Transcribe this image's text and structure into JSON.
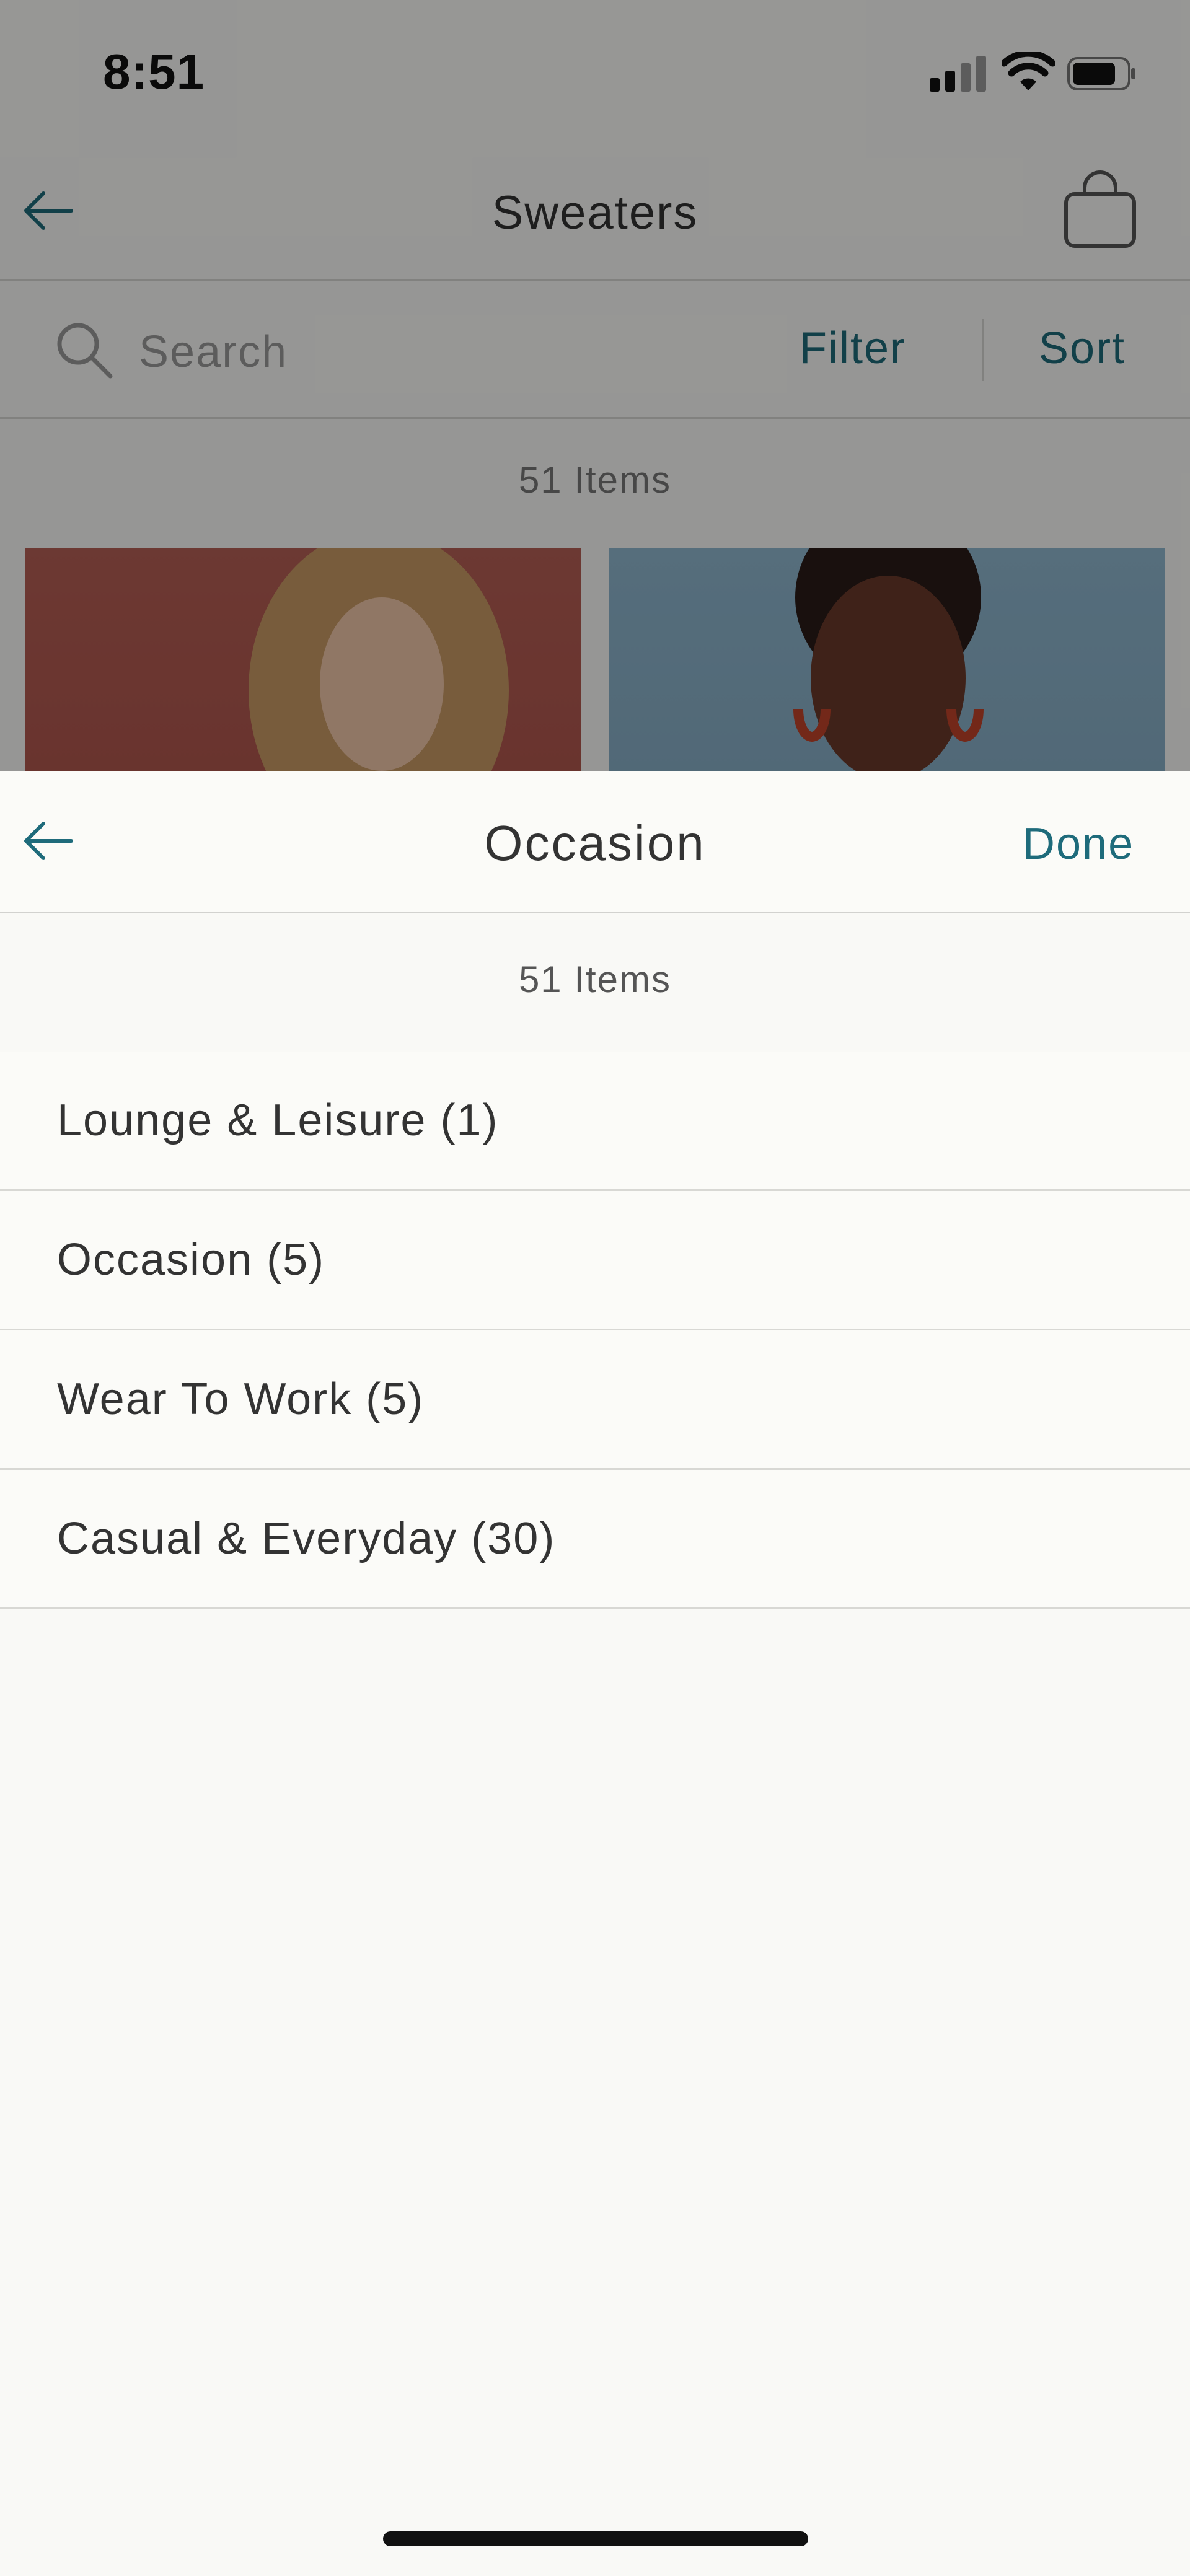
{
  "status_bar": {
    "time": "8:51"
  },
  "background": {
    "title": "Sweaters",
    "search": {
      "placeholder": "Search"
    },
    "filter_label": "Filter",
    "sort_label": "Sort",
    "item_count": "51 Items"
  },
  "sheet": {
    "title": "Occasion",
    "done_label": "Done",
    "item_count": "51 Items",
    "options": [
      {
        "label": "Lounge & Leisure (1)"
      },
      {
        "label": "Occasion (5)"
      },
      {
        "label": "Wear To Work (5)"
      },
      {
        "label": "Casual & Everyday (30)"
      }
    ]
  },
  "colors": {
    "accent": "#1e6b7b",
    "background": "#f9f9f6",
    "divider": "#d8d8d4",
    "text": "#333333"
  },
  "icons": [
    "back-arrow-icon",
    "shopping-bag-icon",
    "search-icon",
    "signal-icon",
    "wifi-icon",
    "battery-icon"
  ]
}
